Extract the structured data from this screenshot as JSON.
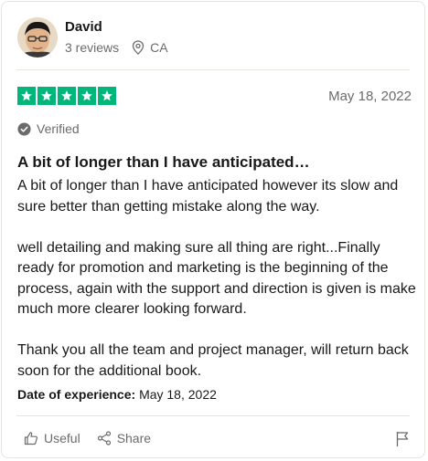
{
  "reviewer": {
    "name": "David",
    "reviews_count": "3 reviews",
    "location": "CA"
  },
  "review": {
    "rating": 5,
    "rating_color": "#00b67a",
    "date": "May 18, 2022",
    "verified_label": "Verified",
    "title": "A bit of longer than I have anticipated…",
    "paragraphs": [
      "A bit of longer than I have anticipated however its slow and sure better than getting mistake along the way.",
      "well detailing and making sure all thing are right...Finally ready for promotion and marketing is the beginning of the process, again with the support and direction is given is make much more clearer looking forward.",
      "Thank you all the team and project manager, will return back soon for the additional book."
    ],
    "experience_label": "Date of experience:",
    "experience_date": "May 18, 2022"
  },
  "actions": {
    "useful_label": "Useful",
    "share_label": "Share"
  },
  "icons": {
    "location": "map-pin-icon",
    "verified": "check-circle-icon",
    "useful": "thumbs-up-icon",
    "share": "share-icon",
    "flag": "flag-icon",
    "star": "star-icon"
  }
}
